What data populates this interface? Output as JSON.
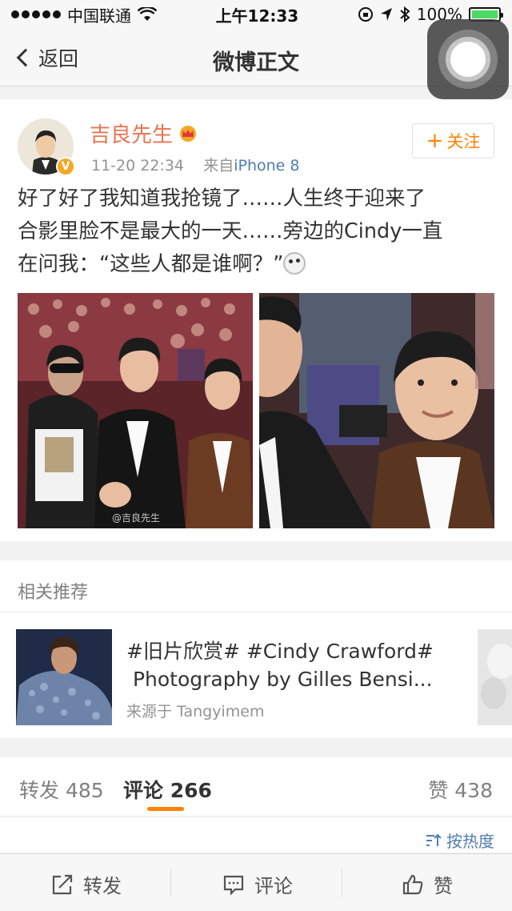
{
  "status_bar": {
    "carrier": "中国联通",
    "time": "上午12:33",
    "battery": "100%"
  },
  "nav": {
    "back_label": "返回",
    "title": "微博正文"
  },
  "post": {
    "username": "吉良先生",
    "time": "11-20 22:34",
    "source_prefix": "来自",
    "source": "iPhone 8",
    "follow_label": "关注",
    "text_line1": "好了好了我知道我抢镜了……人生终于迎来了",
    "text_line2": "合影里脸不是最大的一天……旁边的Cindy一直",
    "text_line3": "在问我：“这些人都是谁啊？”",
    "watermark": "@吉良先生"
  },
  "related": {
    "title": "相关推荐",
    "item_text_line1": "#旧片欣赏# #Cindy Crawford#",
    "item_text_line2": " Photography by Gilles Bensi...",
    "item_source": "来源于 Tangyimem"
  },
  "tabs": {
    "repost_label": "转发",
    "repost_count": "485",
    "comment_label": "评论",
    "comment_count": "266",
    "like_label": "赞",
    "like_count": "438"
  },
  "sort": {
    "label": "按热度"
  },
  "toolbar": {
    "repost": "转发",
    "comment": "评论",
    "like": "赞"
  },
  "colors": {
    "accent": "#ff8200",
    "username": "#eb7350",
    "link": "#507daf"
  }
}
